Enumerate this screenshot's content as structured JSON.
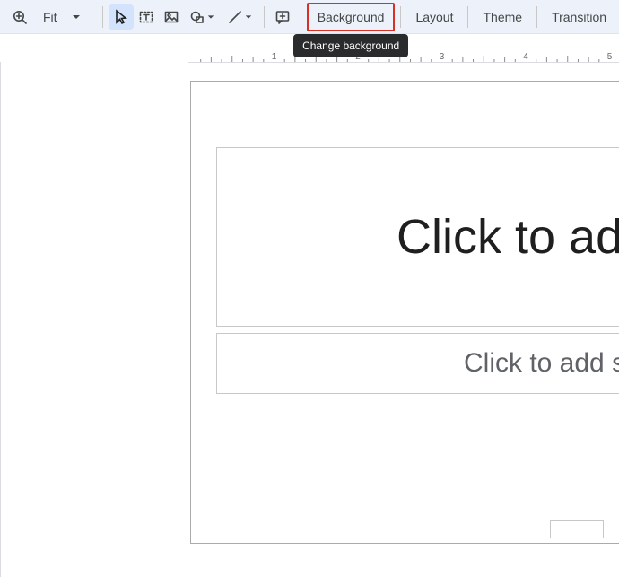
{
  "toolbar": {
    "zoom_label": "Fit",
    "background_label": "Background",
    "layout_label": "Layout",
    "theme_label": "Theme",
    "transition_label": "Transition"
  },
  "tooltip": {
    "change_background": "Change background"
  },
  "slide": {
    "title_placeholder": "Click to add title",
    "subtitle_placeholder": "Click to add subtitle"
  },
  "ruler": {
    "labels": [
      "1",
      "2",
      "3",
      "4",
      "5"
    ]
  }
}
